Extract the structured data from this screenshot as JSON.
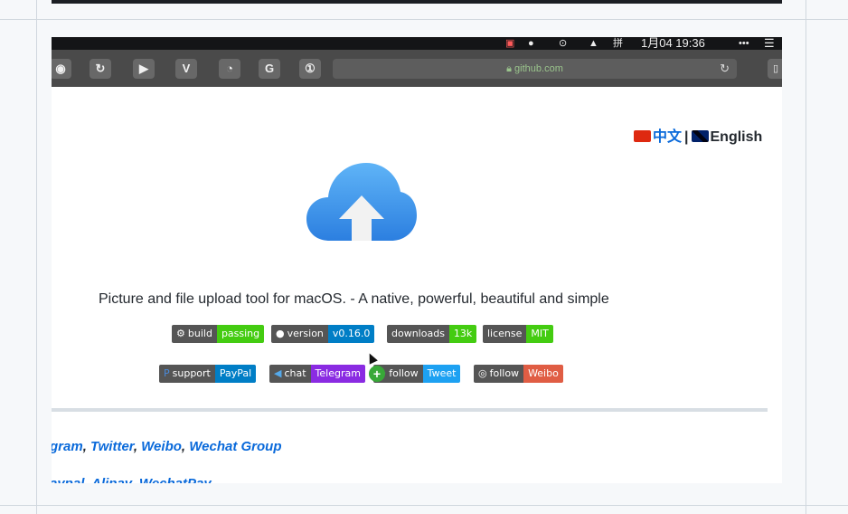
{
  "menubar": {
    "icons": [
      "screenrecord-icon",
      "chat-icon",
      "password-icon",
      "notification-bell-icon",
      "input-method-icon"
    ],
    "input_method": "拼",
    "clock": "1月04 19:36",
    "more": "•••",
    "list": "☰"
  },
  "toolbar": {
    "url": "github.com",
    "buttons": [
      "extension-1-icon",
      "extension-2-icon",
      "media-icon",
      "video-icon",
      "rss-icon",
      "grammarly-icon",
      "onepassword-icon"
    ]
  },
  "page": {
    "lang_zh": "中文",
    "lang_sep": "|",
    "lang_en": "English",
    "tagline": "Picture and file upload tool for macOS. - A native, powerful, beautiful and simple",
    "badges_row1": [
      {
        "key": "build",
        "value": "passing",
        "color": "#4c1"
      },
      {
        "key": "version",
        "value": "v0.16.0",
        "color": "#007ec6"
      },
      {
        "key": "downloads",
        "value": "13k",
        "color": "#4c1"
      },
      {
        "key": "license",
        "value": "MIT",
        "color": "#4c1"
      }
    ],
    "badges_row2": [
      {
        "key": "support",
        "value": "PayPal",
        "color": "#007ec6"
      },
      {
        "key": "chat",
        "value": "Telegram",
        "color": "#8a2be2"
      },
      {
        "key": "follow",
        "value": "Tweet",
        "color": "#1da1f2"
      },
      {
        "key": "follow",
        "value": "Weibo",
        "color": "#e05d44"
      }
    ],
    "social": {
      "telegram_partial": "gram",
      "sep1": ", ",
      "twitter": "Twitter",
      "sep2": ", ",
      "weibo": "Weibo",
      "sep3": ", ",
      "wechat": "Wechat Group"
    },
    "donate_partial": "aypal, Alipay, WechatPay"
  }
}
